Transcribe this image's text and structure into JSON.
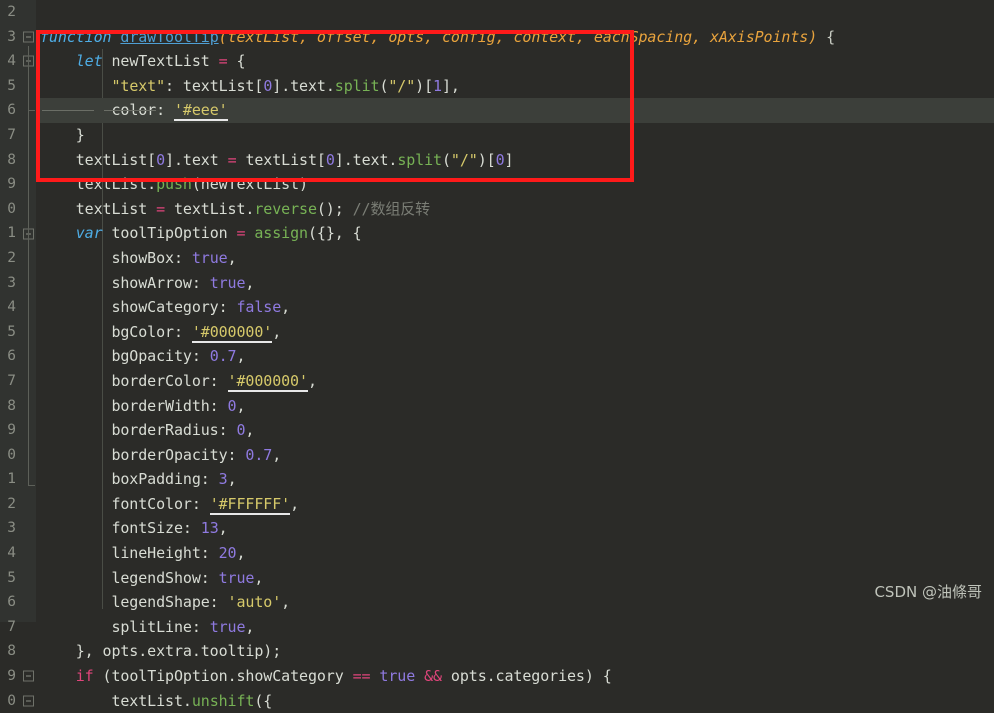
{
  "editor": {
    "background_color": "#2b2b28",
    "gutter_color": "#313330",
    "current_line_color": "#3c3f3a",
    "annotation_color": "#ff1a1a",
    "current_line_number": "6"
  },
  "watermark": {
    "text": "CSDN @油條哥"
  },
  "gutter": {
    "line_numbers": [
      "2",
      "3",
      "4",
      "5",
      "6",
      "7",
      "8",
      "9",
      "0",
      "1",
      "2",
      "3",
      "4",
      "5",
      "6",
      "7",
      "8",
      "9",
      "0",
      "1",
      "2",
      "3",
      "4",
      "5",
      "6",
      "7",
      "8",
      "9",
      "0"
    ]
  },
  "code": {
    "lines": [
      {
        "n": "2",
        "fold": false,
        "tokens": []
      },
      {
        "n": "3",
        "fold": true,
        "tokens": [
          {
            "t": "function",
            "c": "kwi"
          },
          {
            "t": " ",
            "c": "punct"
          },
          {
            "t": "drawToolTip",
            "c": "fn"
          },
          {
            "t": "(",
            "c": "param"
          },
          {
            "t": "textList",
            "c": "param"
          },
          {
            "t": ", ",
            "c": "param"
          },
          {
            "t": "offset",
            "c": "param"
          },
          {
            "t": ", ",
            "c": "param"
          },
          {
            "t": "opts",
            "c": "param"
          },
          {
            "t": ", ",
            "c": "param"
          },
          {
            "t": "config",
            "c": "param"
          },
          {
            "t": ", ",
            "c": "param"
          },
          {
            "t": "context",
            "c": "param"
          },
          {
            "t": ", ",
            "c": "param"
          },
          {
            "t": "eachSpacing",
            "c": "param"
          },
          {
            "t": ", ",
            "c": "param"
          },
          {
            "t": "xAxisPoints",
            "c": "param"
          },
          {
            "t": ")",
            "c": "param"
          },
          {
            "t": " {",
            "c": "punct"
          }
        ]
      },
      {
        "n": "4",
        "fold": true,
        "tokens": [
          {
            "t": "    ",
            "c": "punct"
          },
          {
            "t": "let",
            "c": "kwi"
          },
          {
            "t": " newTextList ",
            "c": "white"
          },
          {
            "t": "=",
            "c": "op"
          },
          {
            "t": " {",
            "c": "white"
          }
        ]
      },
      {
        "n": "5",
        "fold": false,
        "tokens": [
          {
            "t": "        ",
            "c": "punct"
          },
          {
            "t": "\"text\"",
            "c": "str"
          },
          {
            "t": ": ",
            "c": "white"
          },
          {
            "t": "textList",
            "c": "white"
          },
          {
            "t": "[",
            "c": "white"
          },
          {
            "t": "0",
            "c": "num"
          },
          {
            "t": "]",
            "c": "white"
          },
          {
            "t": ".text.",
            "c": "white"
          },
          {
            "t": "split",
            "c": "meth"
          },
          {
            "t": "(",
            "c": "white"
          },
          {
            "t": "\"/\"",
            "c": "str"
          },
          {
            "t": ")[",
            "c": "white"
          },
          {
            "t": "1",
            "c": "num"
          },
          {
            "t": "],",
            "c": "white"
          }
        ]
      },
      {
        "n": "6",
        "fold": false,
        "current": true,
        "tokens": [
          {
            "t": "        ",
            "c": "punct"
          },
          {
            "t": "color",
            "c": "white"
          },
          {
            "t": ": ",
            "c": "white"
          },
          {
            "t": "'#eee'",
            "c": "strc"
          }
        ]
      },
      {
        "n": "7",
        "fold": false,
        "tokens": [
          {
            "t": "    }",
            "c": "white"
          }
        ]
      },
      {
        "n": "8",
        "fold": false,
        "tokens": [
          {
            "t": "    textList",
            "c": "white"
          },
          {
            "t": "[",
            "c": "white"
          },
          {
            "t": "0",
            "c": "num"
          },
          {
            "t": "]",
            "c": "white"
          },
          {
            "t": ".text ",
            "c": "white"
          },
          {
            "t": "=",
            "c": "op"
          },
          {
            "t": " textList",
            "c": "white"
          },
          {
            "t": "[",
            "c": "white"
          },
          {
            "t": "0",
            "c": "num"
          },
          {
            "t": "]",
            "c": "white"
          },
          {
            "t": ".text.",
            "c": "white"
          },
          {
            "t": "split",
            "c": "meth"
          },
          {
            "t": "(",
            "c": "white"
          },
          {
            "t": "\"/\"",
            "c": "str"
          },
          {
            "t": ")[",
            "c": "white"
          },
          {
            "t": "0",
            "c": "num"
          },
          {
            "t": "]",
            "c": "white"
          }
        ]
      },
      {
        "n": "9",
        "fold": false,
        "tokens": [
          {
            "t": "    textList.",
            "c": "white"
          },
          {
            "t": "push",
            "c": "meth"
          },
          {
            "t": "(newTextList)",
            "c": "white"
          }
        ]
      },
      {
        "n": "0",
        "fold": false,
        "tokens": [
          {
            "t": "    textList ",
            "c": "white"
          },
          {
            "t": "=",
            "c": "op"
          },
          {
            "t": " textList.",
            "c": "white"
          },
          {
            "t": "reverse",
            "c": "meth"
          },
          {
            "t": "(); ",
            "c": "white"
          },
          {
            "t": "//数组反转",
            "c": "comment"
          }
        ]
      },
      {
        "n": "1",
        "fold": true,
        "tokens": [
          {
            "t": "    ",
            "c": "punct"
          },
          {
            "t": "var",
            "c": "kwi"
          },
          {
            "t": " toolTipOption ",
            "c": "white"
          },
          {
            "t": "=",
            "c": "op"
          },
          {
            "t": " ",
            "c": "white"
          },
          {
            "t": "assign",
            "c": "meth"
          },
          {
            "t": "({}, {",
            "c": "white"
          }
        ]
      },
      {
        "n": "2",
        "fold": false,
        "tokens": [
          {
            "t": "        showBox: ",
            "c": "white"
          },
          {
            "t": "true",
            "c": "bool"
          },
          {
            "t": ",",
            "c": "white"
          }
        ]
      },
      {
        "n": "3",
        "fold": false,
        "tokens": [
          {
            "t": "        showArrow: ",
            "c": "white"
          },
          {
            "t": "true",
            "c": "bool"
          },
          {
            "t": ",",
            "c": "white"
          }
        ]
      },
      {
        "n": "4",
        "fold": false,
        "tokens": [
          {
            "t": "        showCategory: ",
            "c": "white"
          },
          {
            "t": "false",
            "c": "bool"
          },
          {
            "t": ",",
            "c": "white"
          }
        ]
      },
      {
        "n": "5",
        "fold": false,
        "tokens": [
          {
            "t": "        bgColor: ",
            "c": "white"
          },
          {
            "t": "'#000000'",
            "c": "strc"
          },
          {
            "t": ",",
            "c": "white"
          }
        ]
      },
      {
        "n": "6",
        "fold": false,
        "tokens": [
          {
            "t": "        bgOpacity: ",
            "c": "white"
          },
          {
            "t": "0.7",
            "c": "num"
          },
          {
            "t": ",",
            "c": "white"
          }
        ]
      },
      {
        "n": "7",
        "fold": false,
        "tokens": [
          {
            "t": "        borderColor: ",
            "c": "white"
          },
          {
            "t": "'#000000'",
            "c": "strc"
          },
          {
            "t": ",",
            "c": "white"
          }
        ]
      },
      {
        "n": "8",
        "fold": false,
        "tokens": [
          {
            "t": "        borderWidth: ",
            "c": "white"
          },
          {
            "t": "0",
            "c": "num"
          },
          {
            "t": ",",
            "c": "white"
          }
        ]
      },
      {
        "n": "9",
        "fold": false,
        "tokens": [
          {
            "t": "        borderRadius: ",
            "c": "white"
          },
          {
            "t": "0",
            "c": "num"
          },
          {
            "t": ",",
            "c": "white"
          }
        ]
      },
      {
        "n": "0",
        "fold": false,
        "tokens": [
          {
            "t": "        borderOpacity: ",
            "c": "white"
          },
          {
            "t": "0.7",
            "c": "num"
          },
          {
            "t": ",",
            "c": "white"
          }
        ]
      },
      {
        "n": "1",
        "fold": false,
        "tokens": [
          {
            "t": "        boxPadding: ",
            "c": "white"
          },
          {
            "t": "3",
            "c": "num"
          },
          {
            "t": ",",
            "c": "white"
          }
        ]
      },
      {
        "n": "2",
        "fold": false,
        "tokens": [
          {
            "t": "        fontColor: ",
            "c": "white"
          },
          {
            "t": "'#FFFFFF'",
            "c": "strc"
          },
          {
            "t": ",",
            "c": "white"
          }
        ]
      },
      {
        "n": "3",
        "fold": false,
        "tokens": [
          {
            "t": "        fontSize: ",
            "c": "white"
          },
          {
            "t": "13",
            "c": "num"
          },
          {
            "t": ",",
            "c": "white"
          }
        ]
      },
      {
        "n": "4",
        "fold": false,
        "tokens": [
          {
            "t": "        lineHeight: ",
            "c": "white"
          },
          {
            "t": "20",
            "c": "num"
          },
          {
            "t": ",",
            "c": "white"
          }
        ]
      },
      {
        "n": "5",
        "fold": false,
        "tokens": [
          {
            "t": "        legendShow: ",
            "c": "white"
          },
          {
            "t": "true",
            "c": "bool"
          },
          {
            "t": ",",
            "c": "white"
          }
        ]
      },
      {
        "n": "6",
        "fold": false,
        "tokens": [
          {
            "t": "        legendShape: ",
            "c": "white"
          },
          {
            "t": "'auto'",
            "c": "str"
          },
          {
            "t": ",",
            "c": "white"
          }
        ]
      },
      {
        "n": "7",
        "fold": false,
        "tokens": [
          {
            "t": "        splitLine: ",
            "c": "white"
          },
          {
            "t": "true",
            "c": "bool"
          },
          {
            "t": ",",
            "c": "white"
          }
        ]
      },
      {
        "n": "8",
        "fold": false,
        "tokens": [
          {
            "t": "    }, opts.extra.tooltip);",
            "c": "white"
          }
        ]
      },
      {
        "n": "9",
        "fold": true,
        "tokens": [
          {
            "t": "    ",
            "c": "punct"
          },
          {
            "t": "if",
            "c": "op"
          },
          {
            "t": " (toolTipOption.showCategory ",
            "c": "white"
          },
          {
            "t": "==",
            "c": "op"
          },
          {
            "t": " ",
            "c": "white"
          },
          {
            "t": "true",
            "c": "bool"
          },
          {
            "t": " ",
            "c": "white"
          },
          {
            "t": "&&",
            "c": "op"
          },
          {
            "t": " opts.categories) {",
            "c": "white"
          }
        ]
      },
      {
        "n": "0",
        "fold": true,
        "tokens": [
          {
            "t": "        textList.",
            "c": "white"
          },
          {
            "t": "unshift",
            "c": "meth"
          },
          {
            "t": "({",
            "c": "white"
          }
        ]
      }
    ]
  },
  "annotation": {
    "label": "highlighted-code-region",
    "color": "#ff1a1a"
  }
}
